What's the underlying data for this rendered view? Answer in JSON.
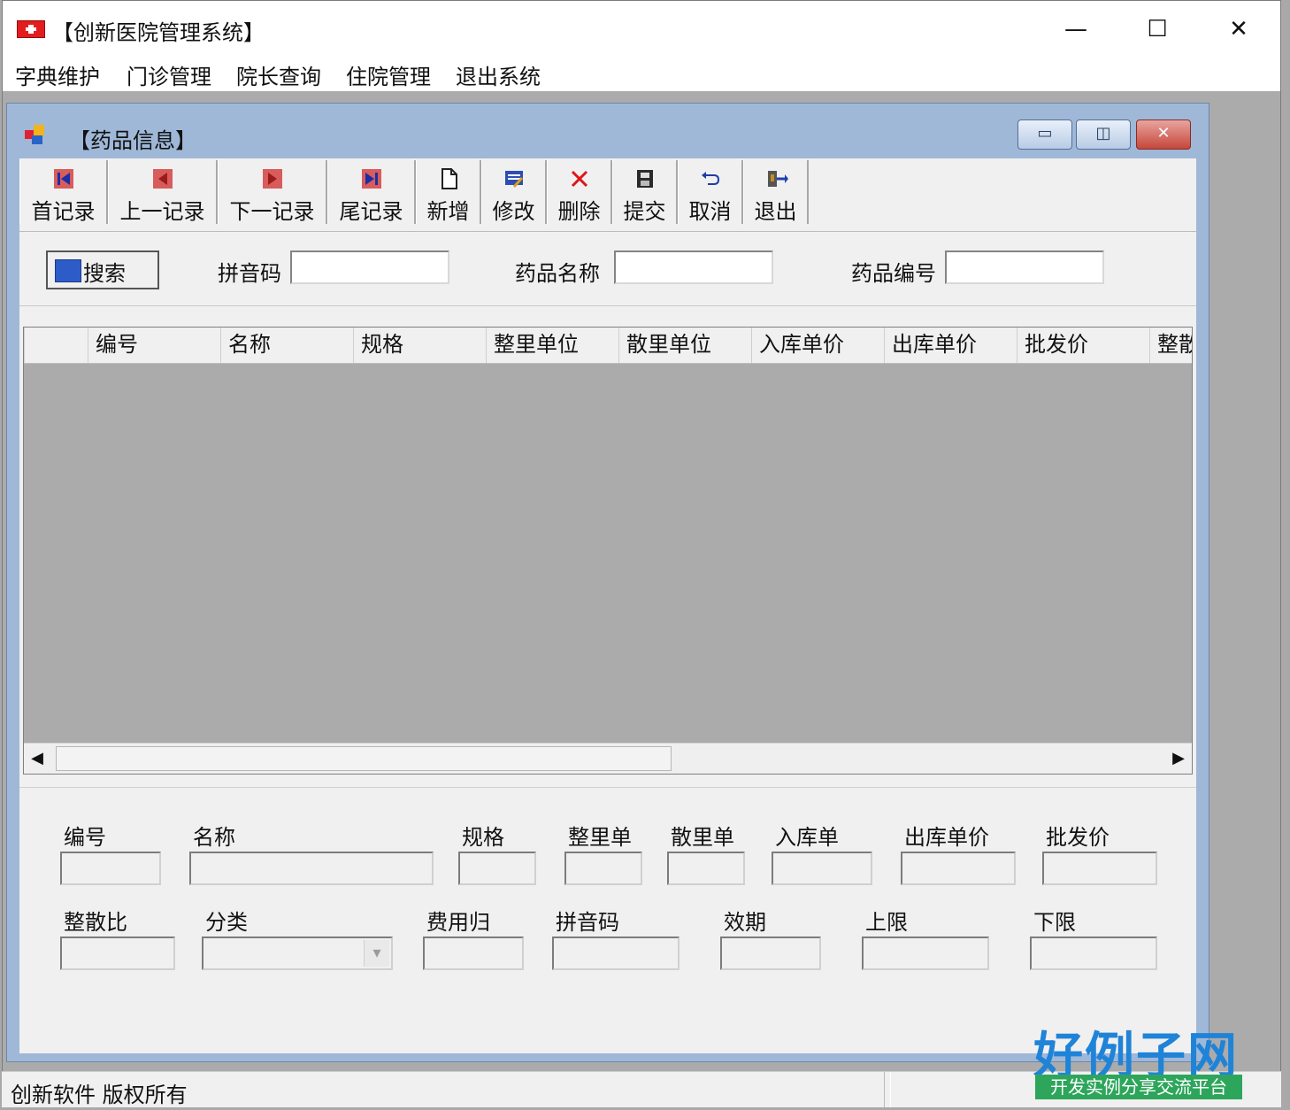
{
  "window": {
    "title": "【创新医院管理系统】",
    "controls": {
      "minimize": "—",
      "maximize": "☐",
      "close": "✕"
    }
  },
  "menu": {
    "items": [
      {
        "label": "字典维护"
      },
      {
        "label": "门诊管理"
      },
      {
        "label": "院长查询"
      },
      {
        "label": "住院管理"
      },
      {
        "label": "退出系统"
      }
    ]
  },
  "child_window": {
    "title": "【药品信息】",
    "controls": {
      "minimize": "▭",
      "restore": "◫",
      "close": "✕"
    }
  },
  "toolbar": {
    "buttons": [
      {
        "label": "首记录",
        "icon": "first-record-icon"
      },
      {
        "label": "上一记录",
        "icon": "previous-record-icon"
      },
      {
        "label": "下一记录",
        "icon": "next-record-icon"
      },
      {
        "label": "尾记录",
        "icon": "last-record-icon"
      },
      {
        "label": "新增",
        "icon": "new-document-icon"
      },
      {
        "label": "修改",
        "icon": "edit-icon"
      },
      {
        "label": "删除",
        "icon": "delete-icon"
      },
      {
        "label": "提交",
        "icon": "save-icon"
      },
      {
        "label": "取消",
        "icon": "undo-icon"
      },
      {
        "label": "退出",
        "icon": "exit-icon"
      }
    ]
  },
  "search": {
    "button_label": "搜索",
    "fields": [
      {
        "label": "拼音码",
        "value": ""
      },
      {
        "label": "药品名称",
        "value": ""
      },
      {
        "label": "药品编号",
        "value": ""
      }
    ]
  },
  "grid": {
    "columns": [
      "编号",
      "名称",
      "规格",
      "整里单位",
      "散里单位",
      "入库单价",
      "出库单价",
      "批发价",
      "整散"
    ],
    "rows": []
  },
  "detail": {
    "row1": [
      {
        "label": "编号",
        "value": ""
      },
      {
        "label": "名称",
        "value": ""
      },
      {
        "label": "规格",
        "value": ""
      },
      {
        "label": "整里单",
        "value": ""
      },
      {
        "label": "散里单",
        "value": ""
      },
      {
        "label": "入库单",
        "value": ""
      },
      {
        "label": "出库单价",
        "value": ""
      },
      {
        "label": "批发价",
        "value": ""
      }
    ],
    "row2": [
      {
        "label": "整散比",
        "value": ""
      },
      {
        "label": "分类",
        "value": ""
      },
      {
        "label": "费用归",
        "value": ""
      },
      {
        "label": "拼音码",
        "value": ""
      },
      {
        "label": "效期",
        "value": ""
      },
      {
        "label": "上限",
        "value": ""
      },
      {
        "label": "下限",
        "value": ""
      }
    ]
  },
  "status": {
    "left_text": "创新软件 版权所有",
    "right_text": ""
  },
  "watermark": {
    "brand": "好例子网",
    "slogan": "开发实例分享交流平台"
  }
}
